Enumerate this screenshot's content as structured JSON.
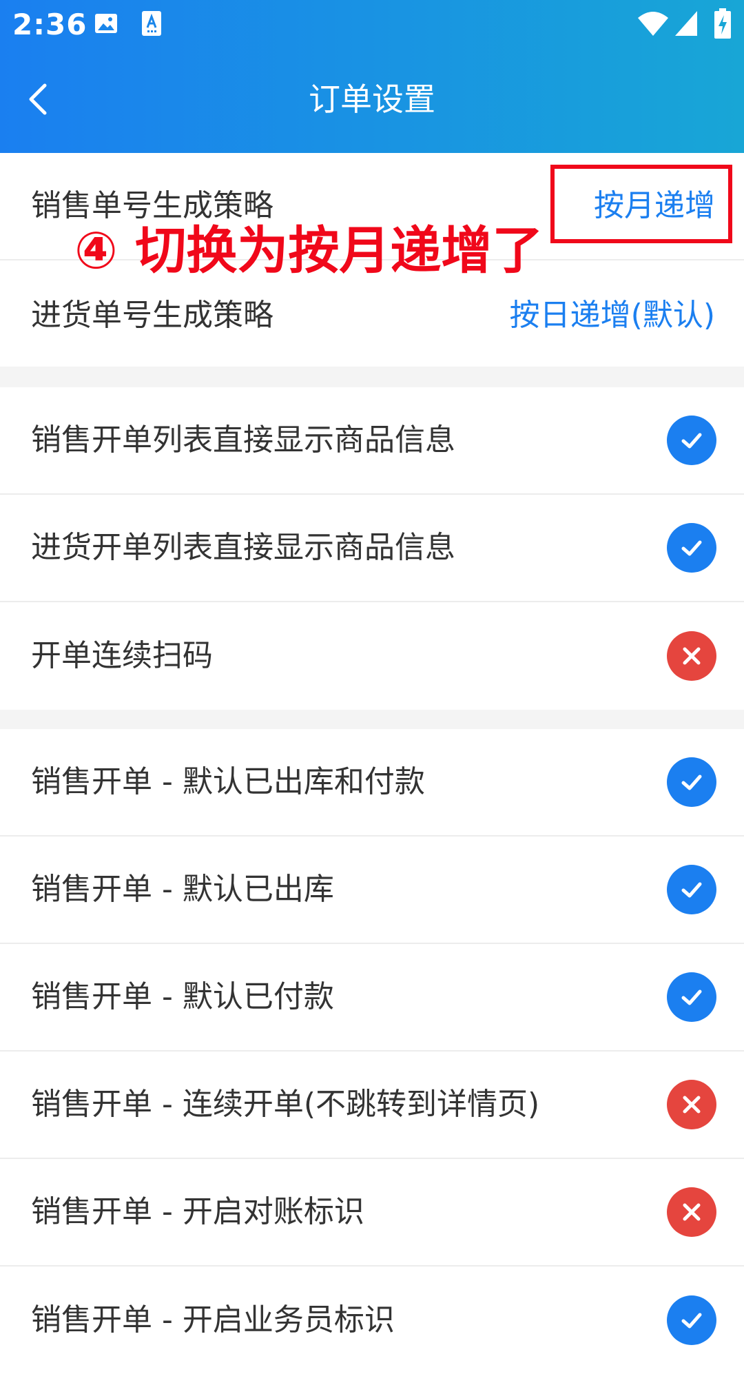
{
  "status_bar": {
    "time": "2:36",
    "icons": [
      "image-icon",
      "font-icon",
      "wifi-icon",
      "signal-icon",
      "battery-charging-icon"
    ]
  },
  "nav": {
    "title": "订单设置",
    "back_icon": "chevron-left-icon"
  },
  "strategies": [
    {
      "label": "销售单号生成策略",
      "value": "按月递增"
    },
    {
      "label": "进货单号生成策略",
      "value": "按日递增(默认)"
    }
  ],
  "annotation": {
    "text": "④ 切换为按月递增了",
    "color": "#f0081a"
  },
  "group_display": [
    {
      "label": "销售开单列表直接显示商品信息",
      "enabled": true
    },
    {
      "label": "进货开单列表直接显示商品信息",
      "enabled": true
    },
    {
      "label": "开单连续扫码",
      "enabled": false
    }
  ],
  "group_sales": [
    {
      "label": "销售开单 - 默认已出库和付款",
      "enabled": true
    },
    {
      "label": "销售开单 - 默认已出库",
      "enabled": true
    },
    {
      "label": "销售开单 - 默认已付款",
      "enabled": true
    },
    {
      "label": "销售开单 - 连续开单(不跳转到详情页)",
      "enabled": false
    },
    {
      "label": "销售开单 - 开启对账标识",
      "enabled": false
    },
    {
      "label": "销售开单 - 开启业务员标识",
      "enabled": true
    }
  ],
  "colors": {
    "accent": "#1b7ff0",
    "header_start": "#1a7ff0",
    "header_end": "#18a6d6",
    "enabled": "#1b7ff0",
    "disabled": "#e5453e"
  }
}
